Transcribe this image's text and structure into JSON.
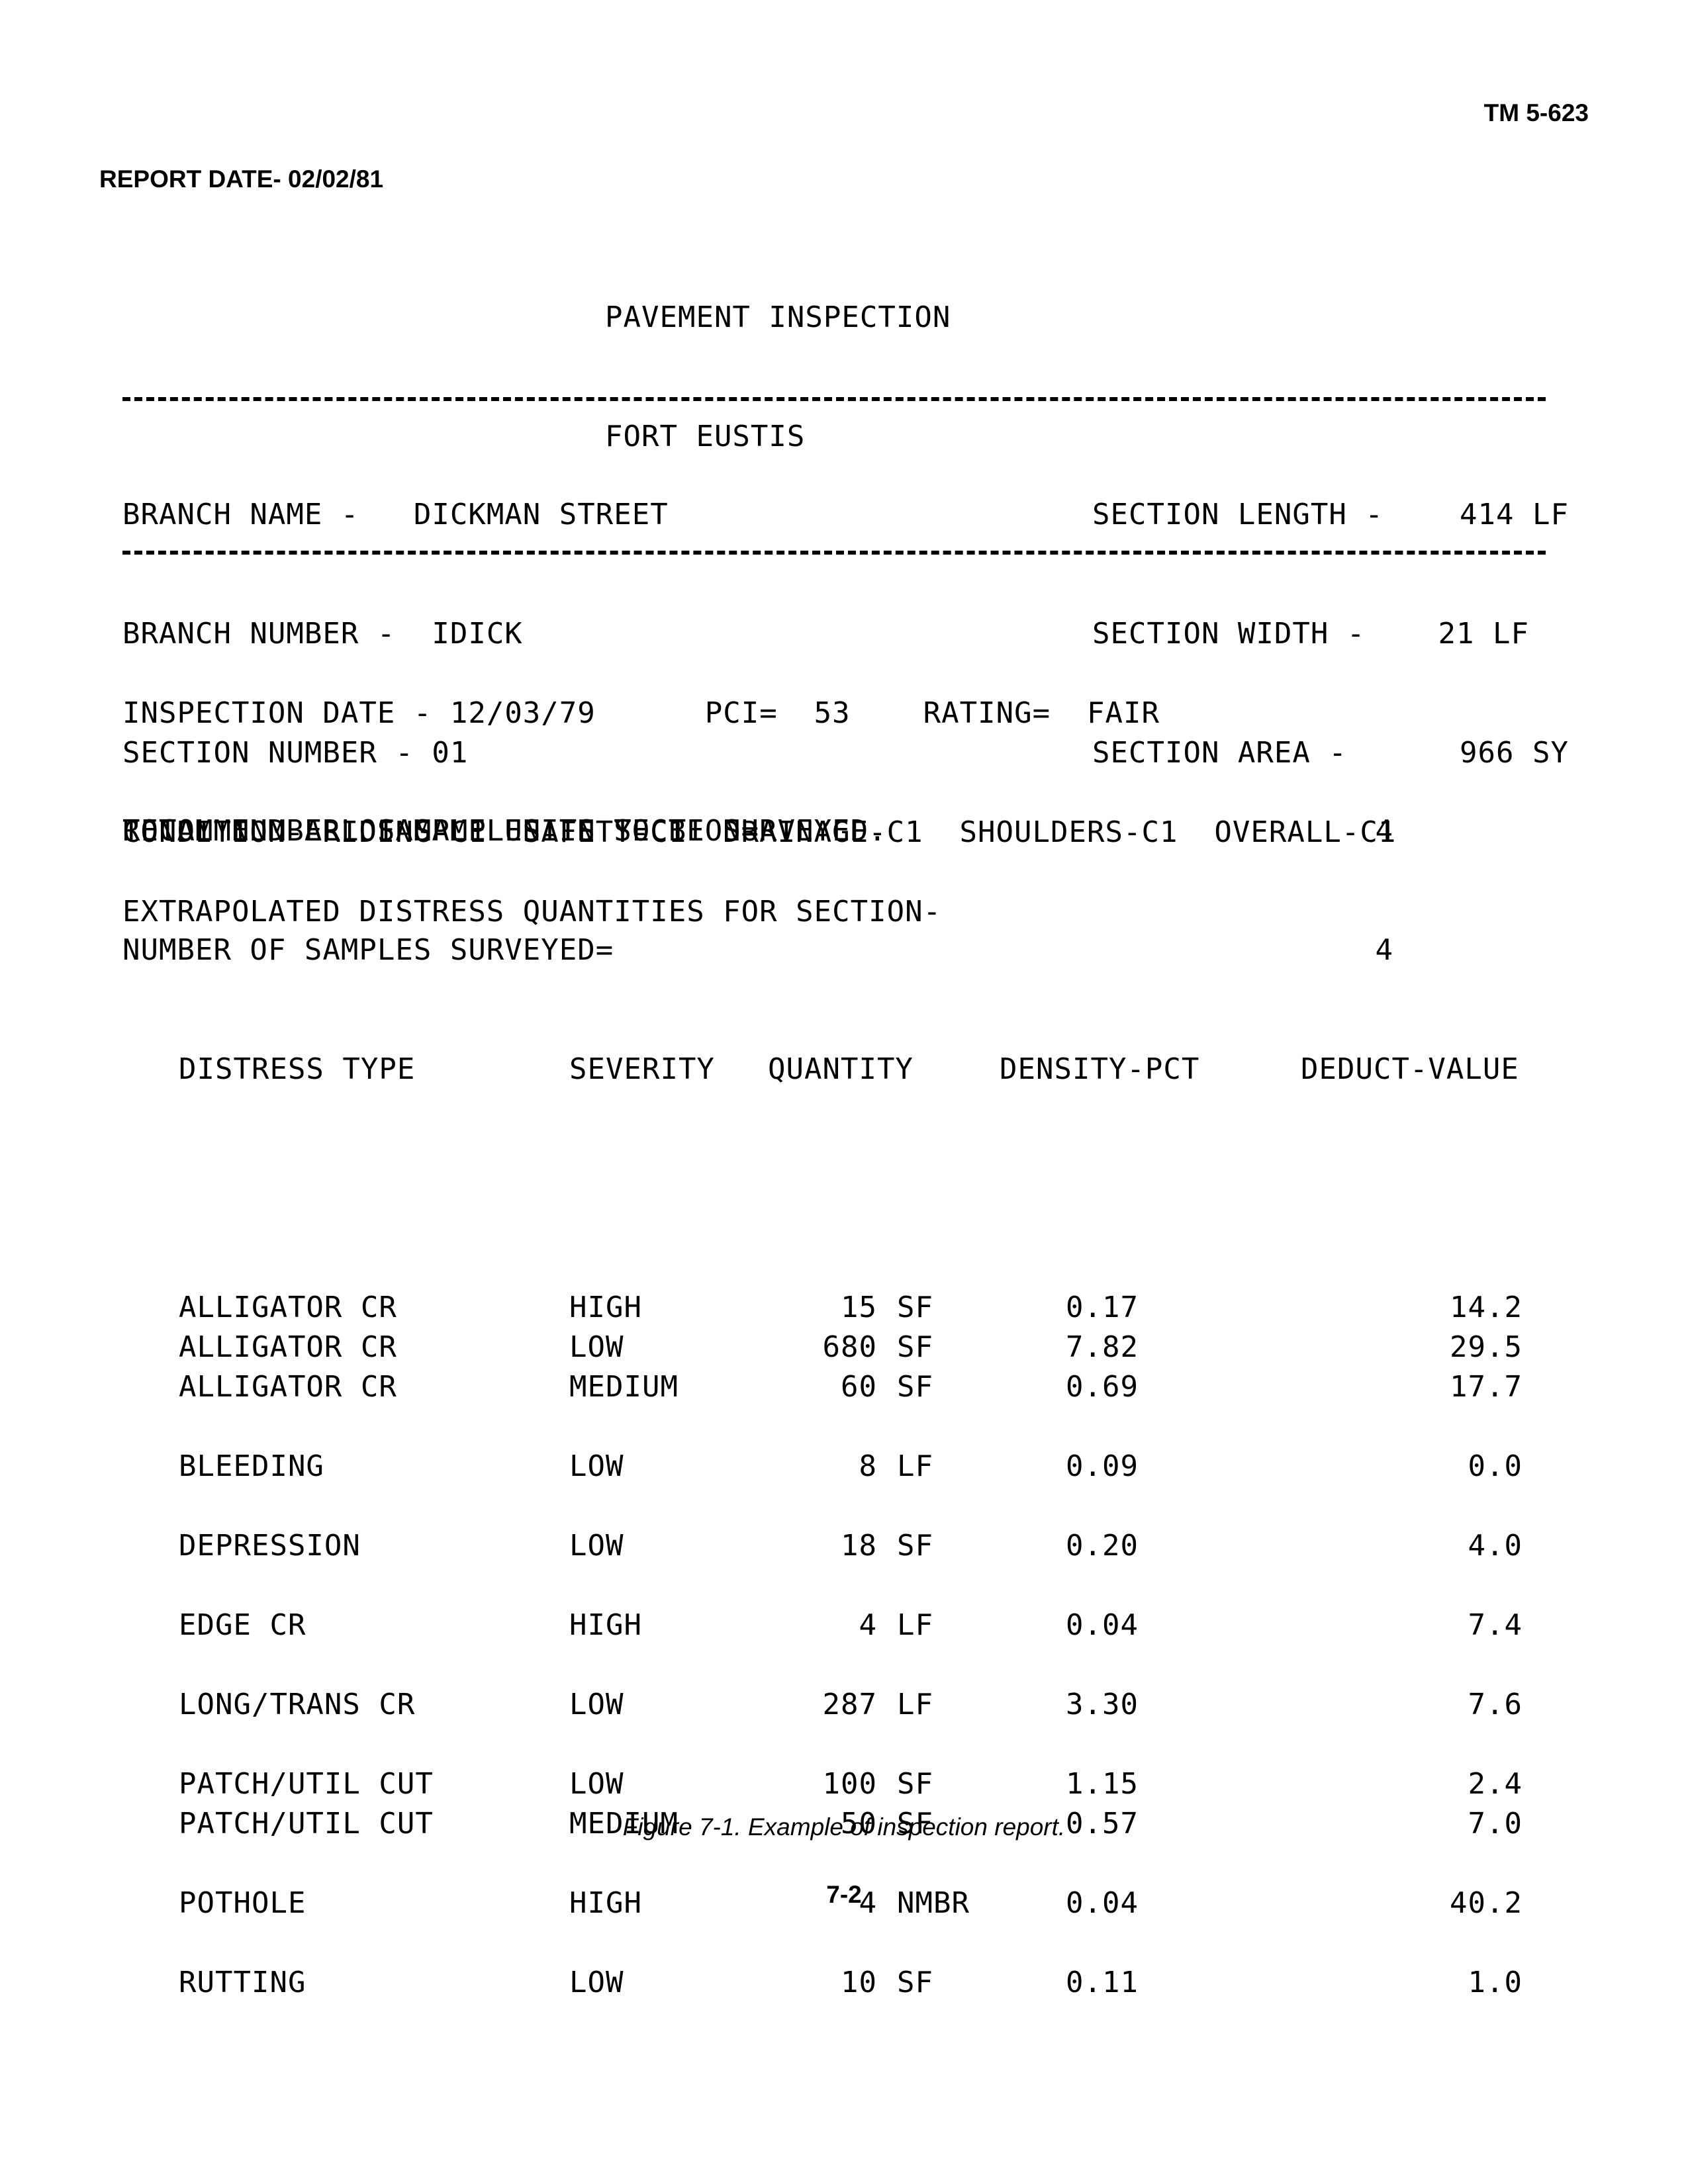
{
  "header": {
    "doc_id": "TM 5-623",
    "report_date": "REPORT DATE- 02/02/81"
  },
  "title": {
    "line1": "PAVEMENT INSPECTION",
    "line2": "FORT EUSTIS"
  },
  "branch": {
    "name_label": "BRANCH NAME -",
    "name_value": "DICKMAN STREET",
    "number_label": "BRANCH NUMBER -",
    "number_value": "IDICK",
    "section_label": "SECTION NUMBER -",
    "section_value": "01"
  },
  "section": {
    "length_label": "SECTION LENGTH -",
    "length_value": "414 LF",
    "width_label": "SECTION WIDTH -",
    "width_value": "21 LF",
    "area_label": "SECTION AREA -",
    "area_value": "966 SY"
  },
  "inspection": {
    "date_label": "INSPECTION DATE -",
    "date_value": "12/03/79",
    "pci_label": "PCI=",
    "pci_value": "53",
    "rating_label": "RATING=",
    "rating_value": "FAIR",
    "condition_line": "CONDITION- RIDING-C1  SAFETY-C1  DRAINAGE-C1  SHOULDERS-C1  OVERALL-C1"
  },
  "samples": {
    "total_label": "TOTAL NUMBER OF SAMPLES IN SECTION=",
    "total_value": "4",
    "surveyed_label": "NUMBER OF SAMPLES SURVEYED=",
    "surveyed_value": "4",
    "recommend": "RECOMMEND ALL SAMPLE UNITS TO BE SURVEYED."
  },
  "extrapolated_heading": "EXTRAPOLATED DISTRESS QUANTITIES FOR SECTION-",
  "table": {
    "headers": [
      "DISTRESS TYPE",
      "SEVERITY",
      "QUANTITY",
      "DENSITY-PCT",
      "DEDUCT-VALUE"
    ],
    "rows": [
      {
        "type": "ALLIGATOR CR",
        "severity": "HIGH",
        "qty": "15",
        "unit": "SF",
        "density": "0.17",
        "deduct": "14.2"
      },
      {
        "type": "ALLIGATOR CR",
        "severity": "LOW",
        "qty": "680",
        "unit": "SF",
        "density": "7.82",
        "deduct": "29.5"
      },
      {
        "type": "ALLIGATOR CR",
        "severity": "MEDIUM",
        "qty": "60",
        "unit": "SF",
        "density": "0.69",
        "deduct": "17.7"
      },
      {
        "type": "BLEEDING",
        "severity": "LOW",
        "qty": "8",
        "unit": "LF",
        "density": "0.09",
        "deduct": "0.0"
      },
      {
        "type": "DEPRESSION",
        "severity": "LOW",
        "qty": "18",
        "unit": "SF",
        "density": "0.20",
        "deduct": "4.0"
      },
      {
        "type": "EDGE CR",
        "severity": "HIGH",
        "qty": "4",
        "unit": "LF",
        "density": "0.04",
        "deduct": "7.4"
      },
      {
        "type": "LONG/TRANS CR",
        "severity": "LOW",
        "qty": "287",
        "unit": "LF",
        "density": "3.30",
        "deduct": "7.6"
      },
      {
        "type": "PATCH/UTIL CUT",
        "severity": "LOW",
        "qty": "100",
        "unit": "SF",
        "density": "1.15",
        "deduct": "2.4"
      },
      {
        "type": "PATCH/UTIL CUT",
        "severity": "MEDIUM",
        "qty": "50",
        "unit": "SF",
        "density": "0.57",
        "deduct": "7.0"
      },
      {
        "type": "POTHOLE",
        "severity": "HIGH",
        "qty": "4",
        "unit": "NMBR",
        "density": "0.04",
        "deduct": "40.2"
      },
      {
        "type": "RUTTING",
        "severity": "LOW",
        "qty": "10",
        "unit": "SF",
        "density": "0.11",
        "deduct": "1.0"
      }
    ]
  },
  "caption": "Figure 7-1.  Example of inspection report.",
  "page_number": "7-2"
}
